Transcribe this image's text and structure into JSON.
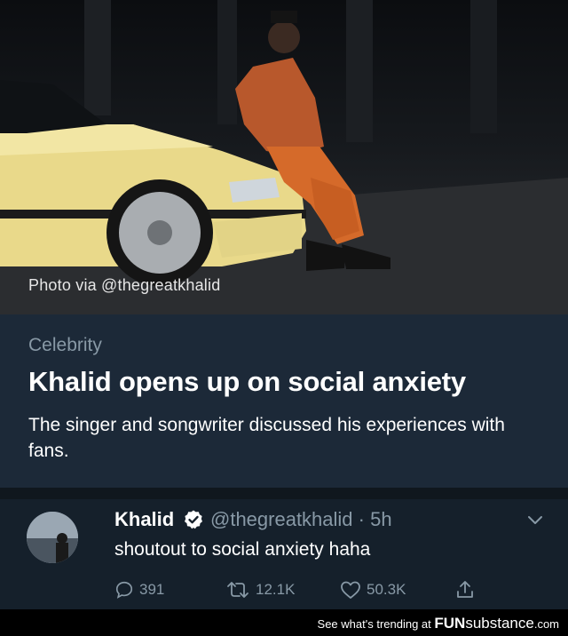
{
  "hero": {
    "credit": "Photo via @thegreatkhalid"
  },
  "card": {
    "category": "Celebrity",
    "headline": "Khalid opens up on social anxiety",
    "description": "The singer and songwriter discussed his experiences with fans."
  },
  "tweet": {
    "name": "Khalid",
    "handle": "@thegreatkhalid",
    "time_sep": "·",
    "time": "5h",
    "text": "shoutout to social anxiety haha",
    "replies": "391",
    "retweets": "12.1K",
    "likes": "50.3K"
  },
  "footer": {
    "prefix": "See what's trending at ",
    "brand_bold": "FUN",
    "brand_rest": "substance",
    "suffix": ".com"
  },
  "colors": {
    "background": "#15202b",
    "card": "#1c2938",
    "muted": "#8899a6",
    "verified": "#ffffff"
  }
}
